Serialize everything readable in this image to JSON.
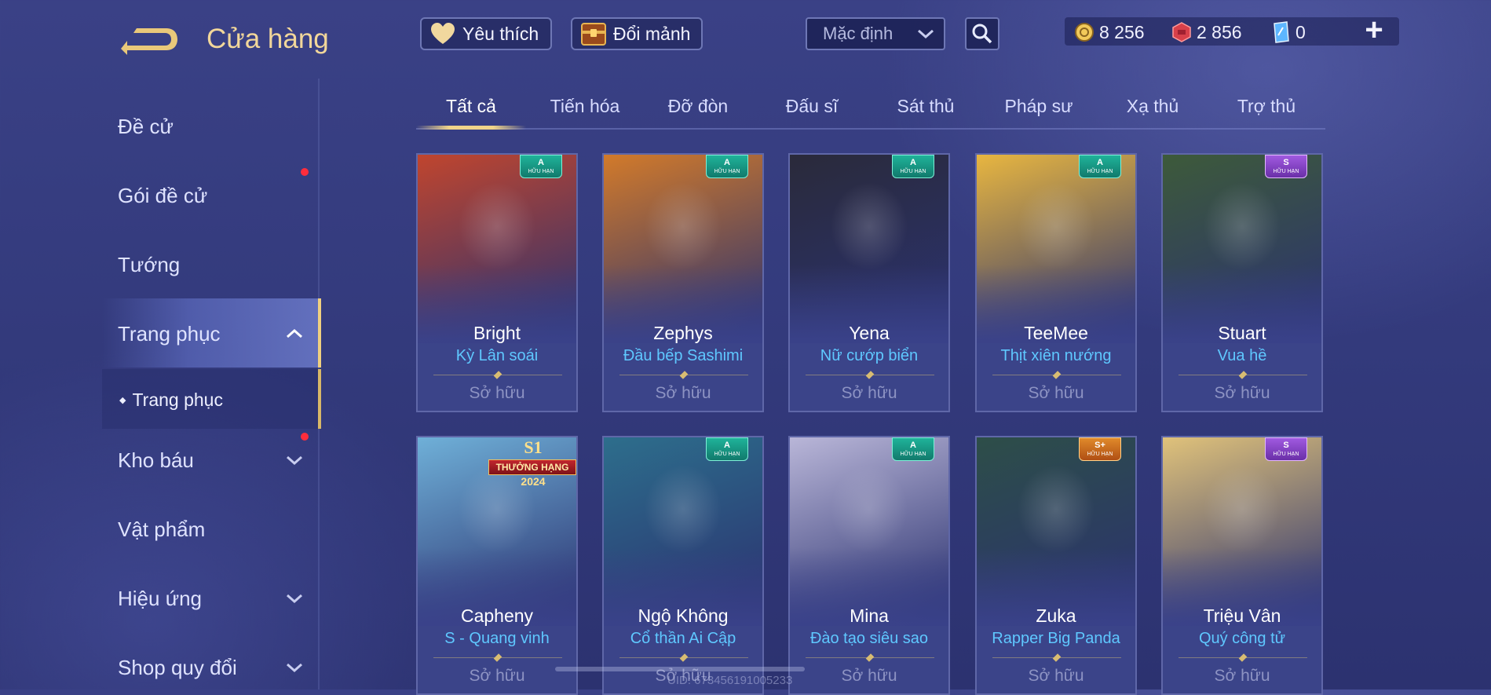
{
  "header": {
    "title": "Cửa hàng",
    "favorite_label": "Yêu thích",
    "shard_exchange_label": "Đổi mảnh",
    "sort_value": "Mặc định",
    "currencies": [
      {
        "name": "gold-coin",
        "value": "8 256"
      },
      {
        "name": "red-voucher",
        "value": "2 856"
      },
      {
        "name": "blue-voucher",
        "value": "0"
      }
    ]
  },
  "sidebar": {
    "items": [
      {
        "label": "Đề cử"
      },
      {
        "label": "Gói đề cử",
        "notification": true
      },
      {
        "label": "Tướng"
      },
      {
        "label": "Trang phục",
        "expanded": true,
        "active": true
      },
      {
        "label": "Kho báu",
        "notification": true,
        "collapsed": true
      },
      {
        "label": "Vật phẩm"
      },
      {
        "label": "Hiệu ứng",
        "collapsed": true
      },
      {
        "label": "Shop quy đổi",
        "collapsed": true
      }
    ],
    "sub_item": {
      "label": "Trang phục",
      "bullet": "◆"
    }
  },
  "tabs": [
    {
      "label": "Tất cả",
      "active": true
    },
    {
      "label": "Tiến hóa"
    },
    {
      "label": "Đỡ đòn"
    },
    {
      "label": "Đấu sĩ"
    },
    {
      "label": "Sát thủ"
    },
    {
      "label": "Pháp sư"
    },
    {
      "label": "Xạ thủ"
    },
    {
      "label": "Trợ thủ"
    }
  ],
  "cards": [
    {
      "hero": "Bright",
      "skin": "Kỳ Lân soái",
      "status": "Sở hữu",
      "tier": "A",
      "limited": "HỮU HẠN",
      "accent": "#c0452e"
    },
    {
      "hero": "Zephys",
      "skin": "Đầu bếp Sashimi",
      "status": "Sở hữu",
      "tier": "A",
      "limited": "HỮU HẠN",
      "accent": "#d27a2a"
    },
    {
      "hero": "Yena",
      "skin": "Nữ cướp biển",
      "status": "Sở hữu",
      "tier": "A",
      "limited": "HỮU HẠN",
      "accent": "#2a2a3a"
    },
    {
      "hero": "TeeMee",
      "skin": "Thịt xiên nướng",
      "status": "Sở hữu",
      "tier": "A",
      "limited": "HỮU HẠN",
      "accent": "#e8b640"
    },
    {
      "hero": "Stuart",
      "skin": "Vua hề",
      "status": "Sở hữu",
      "tier": "S",
      "limited": "HỮU HẠN",
      "accent": "#3d5a3a"
    },
    {
      "hero": "Capheny",
      "skin": "S - Quang vinh",
      "status": "Sở hữu",
      "rank_badge": [
        "S1",
        "THƯỞNG HẠNG",
        "2024"
      ],
      "accent": "#6fb0d8"
    },
    {
      "hero": "Ngộ Không",
      "skin": "Cổ thần Ai Cập",
      "status": "Sở hữu",
      "tier": "A",
      "limited": "HỮU HẠN",
      "accent": "#2d6e8c"
    },
    {
      "hero": "Mina",
      "skin": "Đào tạo siêu sao",
      "status": "Sở hữu",
      "tier": "A",
      "limited": "HỮU HẠN",
      "accent": "#b9b6d8"
    },
    {
      "hero": "Zuka",
      "skin": "Rapper Big Panda",
      "status": "Sở hữu",
      "tier": "S+",
      "limited": "HỮU HẠN",
      "accent": "#2d4e48"
    },
    {
      "hero": "Triệu Vân",
      "skin": "Quý công tử",
      "status": "Sở hữu",
      "tier": "S",
      "limited": "HỮU HẠN",
      "accent": "#e0c27a"
    }
  ],
  "footer": {
    "uid": "UID: 673456191005233"
  }
}
